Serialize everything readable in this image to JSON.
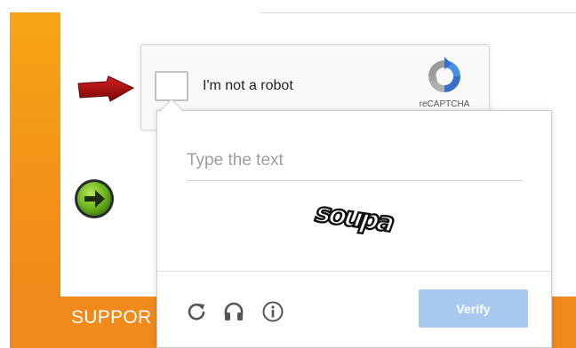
{
  "footer": {
    "support_label": "SUPPOR"
  },
  "recaptcha": {
    "anchor_label": "I'm not a robot",
    "brand_label": "reCAPTCHA",
    "checked": false
  },
  "challenge": {
    "input_placeholder": "Type the text",
    "input_value": "",
    "captcha_text": "soupa",
    "verify_label": "Verify",
    "footer_icons": [
      "reload-icon",
      "audio-headphones-icon",
      "info-icon"
    ]
  },
  "colors": {
    "orange": "#f08a1a",
    "verify_disabled": "#a8c8f0",
    "arrow_red": "#b01010",
    "go_green": "#5ea81e"
  }
}
